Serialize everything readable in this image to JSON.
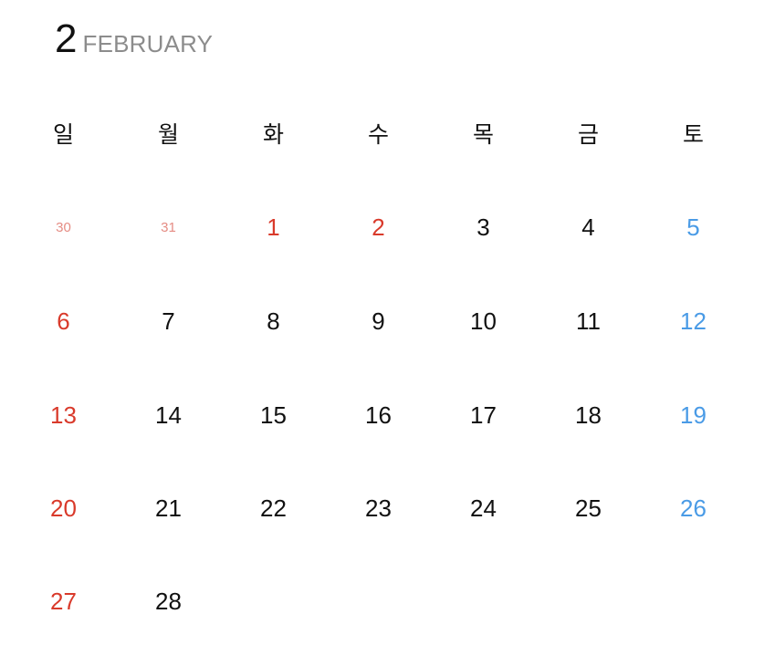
{
  "header": {
    "month_number": "2",
    "month_name": "FEBRUARY"
  },
  "weekdays": [
    "일",
    "월",
    "화",
    "수",
    "목",
    "금",
    "토"
  ],
  "weeks": [
    [
      {
        "text": "30",
        "kind": "prev-month"
      },
      {
        "text": "31",
        "kind": "prev-month"
      },
      {
        "text": "1",
        "kind": "holiday"
      },
      {
        "text": "2",
        "kind": "holiday"
      },
      {
        "text": "3",
        "kind": "weekday"
      },
      {
        "text": "4",
        "kind": "weekday"
      },
      {
        "text": "5",
        "kind": "saturday"
      }
    ],
    [
      {
        "text": "6",
        "kind": "sunday"
      },
      {
        "text": "7",
        "kind": "weekday"
      },
      {
        "text": "8",
        "kind": "weekday"
      },
      {
        "text": "9",
        "kind": "weekday"
      },
      {
        "text": "10",
        "kind": "weekday"
      },
      {
        "text": "11",
        "kind": "weekday"
      },
      {
        "text": "12",
        "kind": "saturday"
      }
    ],
    [
      {
        "text": "13",
        "kind": "sunday"
      },
      {
        "text": "14",
        "kind": "weekday"
      },
      {
        "text": "15",
        "kind": "weekday"
      },
      {
        "text": "16",
        "kind": "weekday"
      },
      {
        "text": "17",
        "kind": "weekday"
      },
      {
        "text": "18",
        "kind": "weekday"
      },
      {
        "text": "19",
        "kind": "saturday"
      }
    ],
    [
      {
        "text": "20",
        "kind": "sunday"
      },
      {
        "text": "21",
        "kind": "weekday"
      },
      {
        "text": "22",
        "kind": "weekday"
      },
      {
        "text": "23",
        "kind": "weekday"
      },
      {
        "text": "24",
        "kind": "weekday"
      },
      {
        "text": "25",
        "kind": "weekday"
      },
      {
        "text": "26",
        "kind": "saturday"
      }
    ],
    [
      {
        "text": "27",
        "kind": "sunday"
      },
      {
        "text": "28",
        "kind": "weekday"
      },
      {
        "text": "",
        "kind": "empty"
      },
      {
        "text": "",
        "kind": "empty"
      },
      {
        "text": "",
        "kind": "empty"
      },
      {
        "text": "",
        "kind": "empty"
      },
      {
        "text": "",
        "kind": "empty"
      }
    ]
  ],
  "colors": {
    "text": "#111111",
    "month_name": "#8c8c8c",
    "sunday_holiday": "#d93a2b",
    "saturday": "#4a9be6",
    "prev_month": "#e58c84"
  }
}
